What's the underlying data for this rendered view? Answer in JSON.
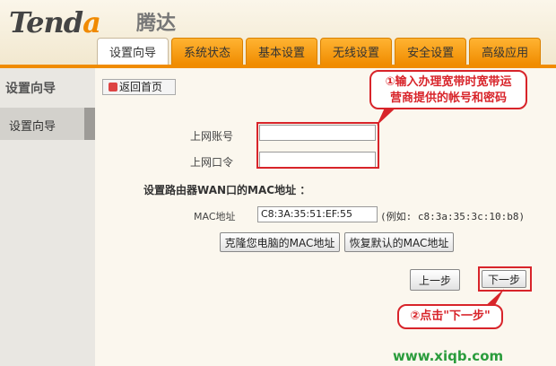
{
  "brand": {
    "name_part1": "Tend",
    "name_part2": "a",
    "name_cn": "腾达"
  },
  "tabs": [
    {
      "label": "设置向导",
      "active": true
    },
    {
      "label": "系统状态"
    },
    {
      "label": "基本设置"
    },
    {
      "label": "无线设置"
    },
    {
      "label": "安全设置"
    },
    {
      "label": "高级应用"
    }
  ],
  "sidebar": {
    "title": "设置向导",
    "items": [
      {
        "label": "设置向导"
      }
    ]
  },
  "toolbar": {
    "home_label": "返回首页"
  },
  "form": {
    "account_label": "上网账号",
    "account_value": "",
    "password_label": "上网口令",
    "password_value": "",
    "mac_section_title": "设置路由器WAN口的MAC地址 ：",
    "mac_label": "MAC地址",
    "mac_value": "C8:3A:35:51:EF:55",
    "mac_example": "(例如: c8:3a:35:3c:10:b8)",
    "clone_mac_label": "克隆您电脑的MAC地址",
    "restore_mac_label": "恢复默认的MAC地址",
    "prev_label": "上一步",
    "next_label": "下一步"
  },
  "annotations": {
    "callout1_line1": "①输入办理宽带时宽带运",
    "callout1_line2": "营商提供的帐号和密码",
    "callout2": "②点击\"下一步\""
  },
  "watermark": "www.xiqb.com",
  "colors": {
    "accent": "#f08c00",
    "annotation": "#d8242a"
  }
}
